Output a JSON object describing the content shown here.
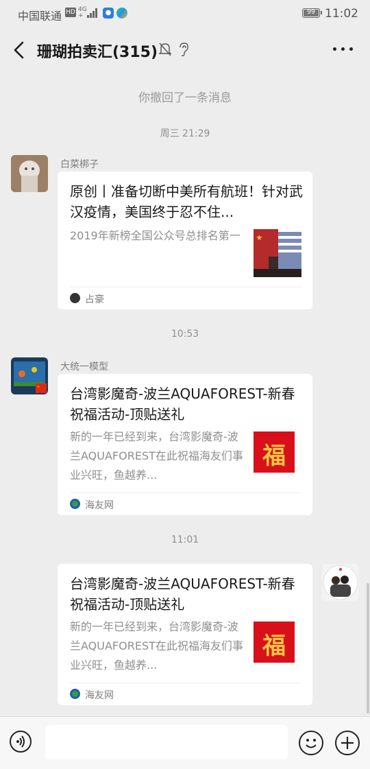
{
  "status_bar": {
    "carrier": "中国联通",
    "hd": "HD",
    "network": "4G",
    "network_sub": "+",
    "app1_icon": "baidu-paw-icon",
    "app2_icon": "tencent-video-icon",
    "battery": "99",
    "time": "11:02"
  },
  "nav": {
    "back_icon": "chevron-left-icon",
    "title": "珊瑚拍卖汇(315)",
    "mute_icon": "bell-off-icon",
    "ear_icon": "ear-icon",
    "more_icon": "more-dots-icon"
  },
  "system": {
    "recall": "你撤回了一条消息"
  },
  "messages": [
    {
      "timestamp": "周三 21:29",
      "sender": "白菜梆子",
      "title": "原创丨准备切断中美所有航班！针对武汉疫情，美国终于忍不住...",
      "desc": "2019年新榜全国公众号总排名第一",
      "source": "占豪",
      "thumb_icon": "flags-thumbnail"
    },
    {
      "timestamp": "10:53",
      "sender": "大统一模型",
      "title": "台湾影魔奇-波兰AQUAFOREST-新春祝福活动-顶贴送礼",
      "desc": "新的一年已经到来，台湾影魔奇-波兰AQUAFOREST在此祝福海友们事业兴旺，鱼越养...",
      "source": "海友网",
      "thumb_text": "福"
    },
    {
      "timestamp": "11:01",
      "title": "台湾影魔奇-波兰AQUAFOREST-新春祝福活动-顶贴送礼",
      "desc": "新的一年已经到来，台湾影魔奇-波兰AQUAFOREST在此祝福海友们事业兴旺，鱼越养...",
      "source": "海友网",
      "thumb_text": "福"
    }
  ],
  "input": {
    "value": "",
    "placeholder": "",
    "voice_icon": "voice-icon",
    "emoji_icon": "emoji-icon",
    "plus_icon": "plus-icon"
  },
  "colors": {
    "background": "#ededed",
    "card": "#ffffff",
    "fu_red": "#d8101c",
    "fu_gold": "#f5c542"
  }
}
